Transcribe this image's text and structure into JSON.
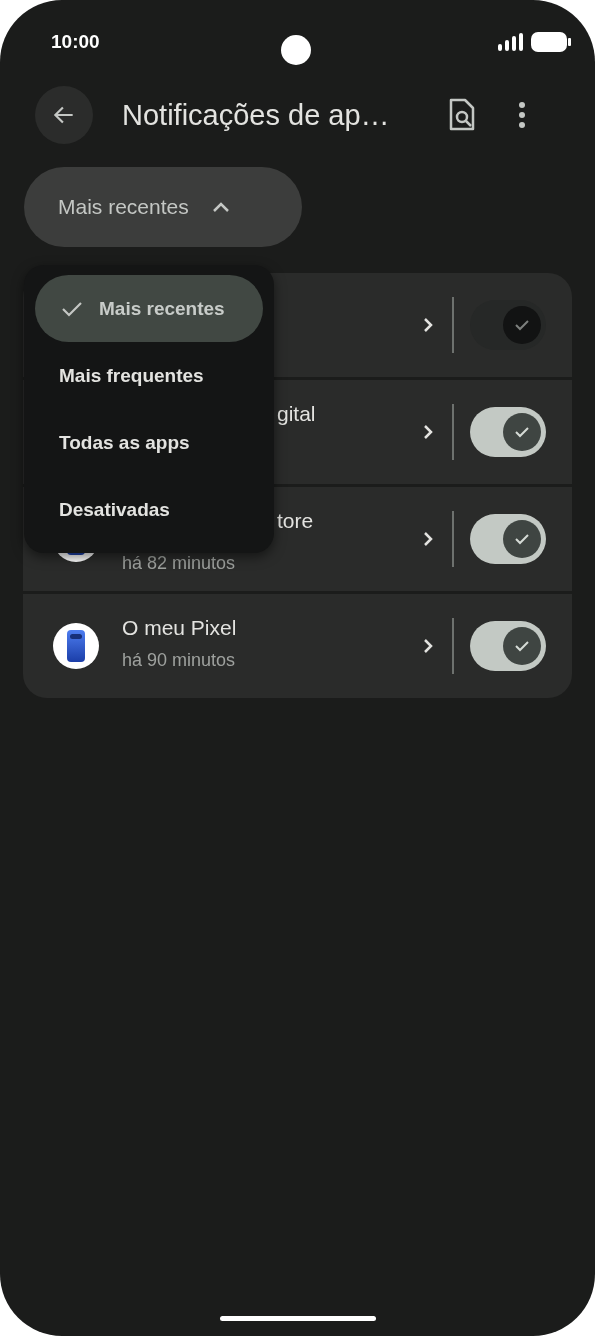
{
  "status_bar": {
    "time": "10:00"
  },
  "top_bar": {
    "title": "Notificações de ap…"
  },
  "filter_chip": {
    "label": "Mais recentes",
    "expanded": true
  },
  "menu": {
    "items": [
      {
        "label": "Mais recentes",
        "selected": true
      },
      {
        "label": "Mais frequentes",
        "selected": false
      },
      {
        "label": "Todas as apps",
        "selected": false
      },
      {
        "label": "Desativadas",
        "selected": false
      }
    ]
  },
  "apps": [
    {
      "icon_visible": false,
      "on": true,
      "disabled": true
    },
    {
      "title": "gital",
      "title_cut": true,
      "icon_visible": false,
      "on": true,
      "disabled": false
    },
    {
      "title": "tore",
      "title_cut": true,
      "subtitle": "há 82 minutos",
      "icon_visible": true,
      "on": true,
      "disabled": false
    },
    {
      "title": "O meu Pixel",
      "title_cut": false,
      "subtitle": "há 90 minutos",
      "icon_visible": true,
      "on": true,
      "disabled": false
    }
  ]
}
